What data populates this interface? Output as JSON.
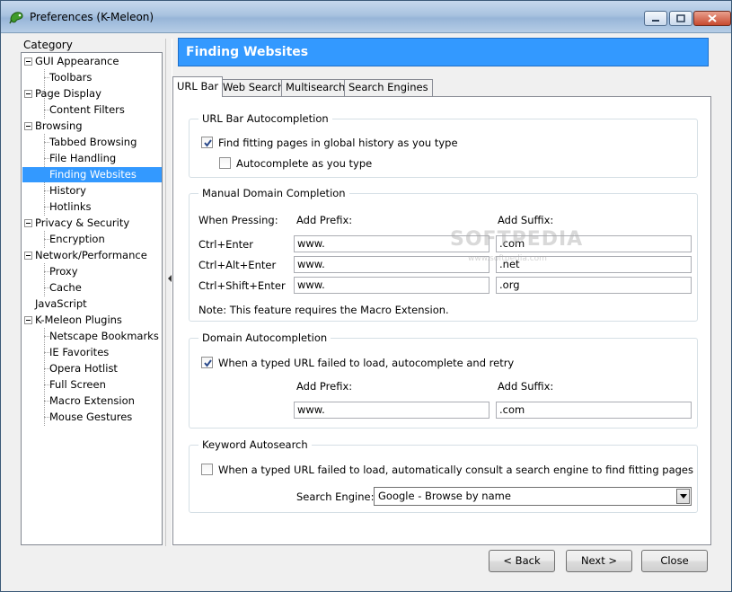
{
  "window": {
    "title": "Preferences (K-Meleon)"
  },
  "sidebar": {
    "category_label": "Category",
    "items": [
      {
        "label": "GUI Appearance"
      },
      {
        "label": "Toolbars"
      },
      {
        "label": "Page Display"
      },
      {
        "label": "Content Filters"
      },
      {
        "label": "Browsing"
      },
      {
        "label": "Tabbed Browsing"
      },
      {
        "label": "File Handling"
      },
      {
        "label": "Finding Websites"
      },
      {
        "label": "History"
      },
      {
        "label": "Hotlinks"
      },
      {
        "label": "Privacy & Security"
      },
      {
        "label": "Encryption"
      },
      {
        "label": "Network/Performance"
      },
      {
        "label": "Proxy"
      },
      {
        "label": "Cache"
      },
      {
        "label": "JavaScript"
      },
      {
        "label": "K-Meleon Plugins"
      },
      {
        "label": "Netscape Bookmarks"
      },
      {
        "label": "IE Favorites"
      },
      {
        "label": "Opera Hotlist"
      },
      {
        "label": "Full Screen"
      },
      {
        "label": "Macro Extension"
      },
      {
        "label": "Mouse Gestures"
      }
    ],
    "selected": "Finding Websites"
  },
  "page": {
    "title": "Finding Websites",
    "tabs": [
      {
        "label": "URL Bar"
      },
      {
        "label": "Web Search"
      },
      {
        "label": "Multisearch"
      },
      {
        "label": "Search Engines"
      }
    ]
  },
  "url_autocompletion": {
    "title": "URL Bar Autocompletion",
    "option1": {
      "label": "Find fitting pages in global history as you type",
      "checked": true
    },
    "option2": {
      "label": "Autocomplete as you type",
      "checked": false
    }
  },
  "manual_domain": {
    "title": "Manual Domain Completion",
    "col_when": "When Pressing:",
    "col_prefix": "Add Prefix:",
    "col_suffix": "Add Suffix:",
    "rows": [
      {
        "key": "Ctrl+Enter",
        "prefix": "www.",
        "suffix": ".com"
      },
      {
        "key": "Ctrl+Alt+Enter",
        "prefix": "www.",
        "suffix": ".net"
      },
      {
        "key": "Ctrl+Shift+Enter",
        "prefix": "www.",
        "suffix": ".org"
      }
    ],
    "note": "Note: This feature requires the Macro Extension."
  },
  "domain_autocompletion": {
    "title": "Domain Autocompletion",
    "option": {
      "label": "When a typed URL failed to load, autocomplete and retry",
      "checked": true
    },
    "prefix_label": "Add Prefix:",
    "suffix_label": "Add Suffix:",
    "prefix": "www.",
    "suffix": ".com"
  },
  "keyword_autosearch": {
    "title": "Keyword Autosearch",
    "option": {
      "label": "When a typed URL failed to load, automatically consult a search engine to find fitting pages",
      "checked": false
    },
    "engine_label": "Search Engine:",
    "engine_value": "Google - Browse by name"
  },
  "buttons": {
    "back": "< Back",
    "next": "Next >",
    "close": "Close"
  },
  "watermark": {
    "main": "SOFTPEDIA",
    "sub": "www.softpedia.com"
  },
  "colors": {
    "accent": "#3399ff",
    "selection": "#3399ff"
  }
}
